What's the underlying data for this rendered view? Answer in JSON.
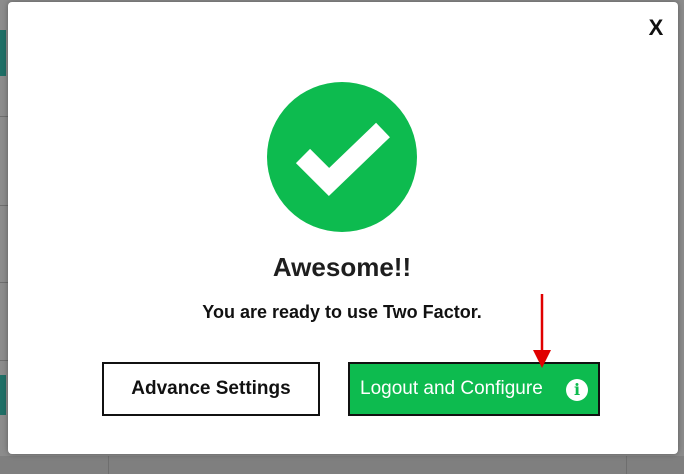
{
  "modal": {
    "close_label": "X",
    "title": "Awesome!!",
    "subtitle": "You are ready to use Two Factor.",
    "advance_button_label": "Advance Settings",
    "logout_button_label": "Logout and Configure",
    "info_icon_glyph": "i"
  },
  "icons": {
    "success": "check-circle-icon",
    "info": "info-icon",
    "close": "close-icon",
    "annotation": "red-arrow-annotation"
  },
  "colors": {
    "success_green": "#0dbb4f",
    "arrow_red": "#e00000"
  }
}
